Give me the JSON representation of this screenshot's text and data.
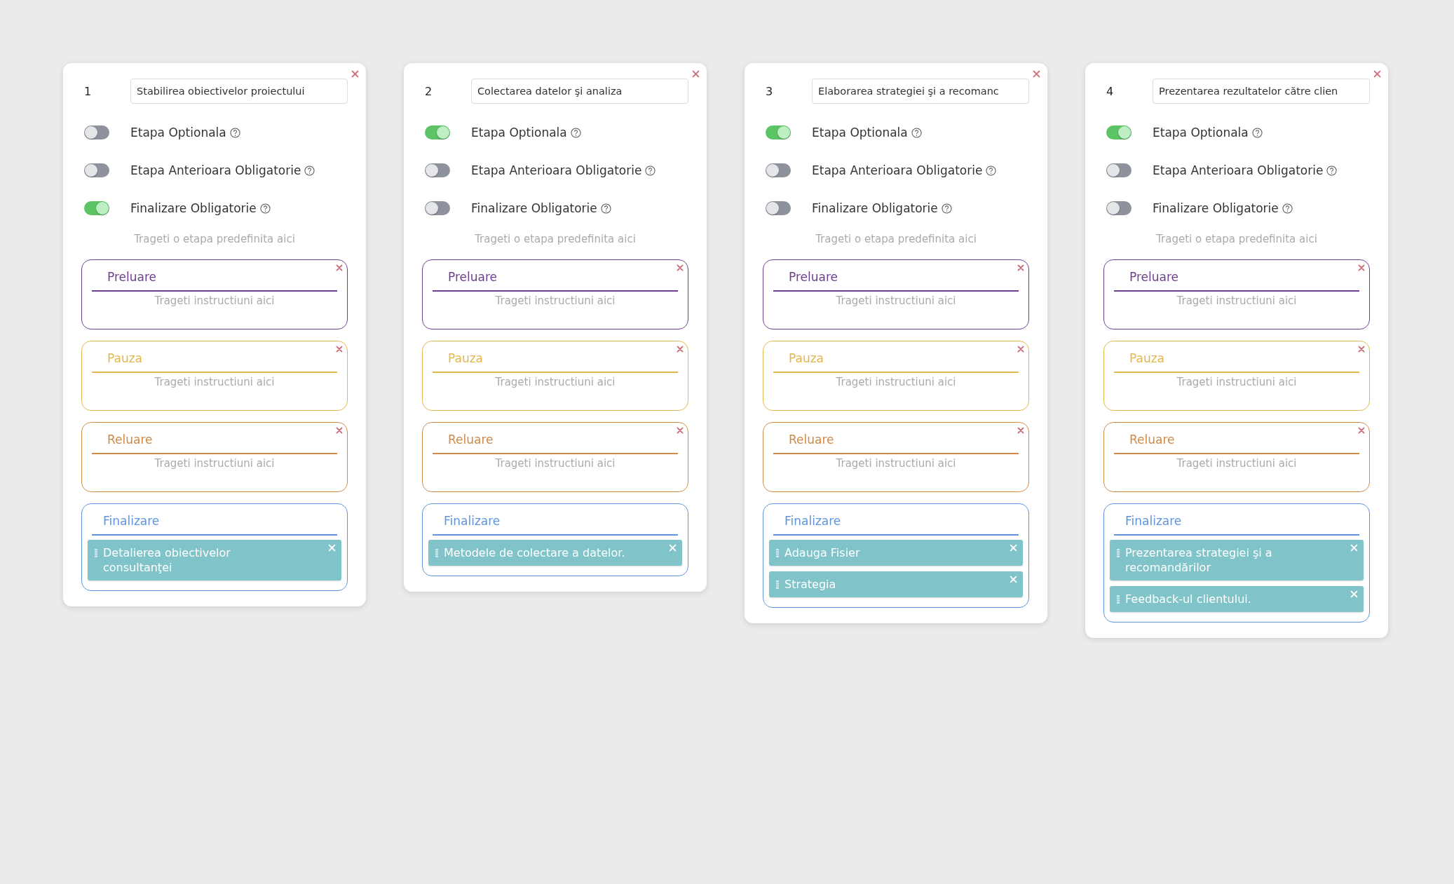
{
  "stages": [
    {
      "number": "1",
      "title": "Stabilirea obiectivelor proiectului",
      "options": [
        {
          "label": "Etapa Optionala",
          "on": false
        },
        {
          "label": "Etapa Anterioara Obligatorie",
          "on": false
        },
        {
          "label": "Finalizare Obligatorie",
          "on": true
        }
      ],
      "drop_hint": "Trageti o etapa predefinita aici",
      "sections": [
        {
          "title": "Preluare",
          "color": "#6f3f8f",
          "closable": true,
          "hint": "Trageti instructiuni aici"
        },
        {
          "title": "Pauza",
          "color": "#e2b84e",
          "closable": true,
          "hint": "Trageti instructiuni aici"
        },
        {
          "title": "Reluare",
          "color": "#d08a48",
          "closable": true,
          "hint": "Trageti instructiuni aici"
        },
        {
          "title": "Finalizare",
          "color": "#5f95de",
          "closable": false,
          "items": [
            "Detalierea obiectivelor consultanţei"
          ]
        }
      ]
    },
    {
      "number": "2",
      "title": "Colectarea datelor şi analiza",
      "options": [
        {
          "label": "Etapa Optionala",
          "on": true
        },
        {
          "label": "Etapa Anterioara Obligatorie",
          "on": false
        },
        {
          "label": "Finalizare Obligatorie",
          "on": false
        }
      ],
      "drop_hint": "Trageti o etapa predefinita aici",
      "sections": [
        {
          "title": "Preluare",
          "color": "#6f3f8f",
          "closable": true,
          "hint": "Trageti instructiuni aici"
        },
        {
          "title": "Pauza",
          "color": "#e2b84e",
          "closable": true,
          "hint": "Trageti instructiuni aici"
        },
        {
          "title": "Reluare",
          "color": "#d08a48",
          "closable": true,
          "hint": "Trageti instructiuni aici"
        },
        {
          "title": "Finalizare",
          "color": "#5f95de",
          "closable": false,
          "items": [
            "Metodele de colectare a datelor."
          ]
        }
      ]
    },
    {
      "number": "3",
      "title": "Elaborarea strategiei şi a recomanc",
      "options": [
        {
          "label": "Etapa Optionala",
          "on": true
        },
        {
          "label": "Etapa Anterioara Obligatorie",
          "on": false
        },
        {
          "label": "Finalizare Obligatorie",
          "on": false
        }
      ],
      "drop_hint": "Trageti o etapa predefinita aici",
      "sections": [
        {
          "title": "Preluare",
          "color": "#6f3f8f",
          "closable": true,
          "hint": "Trageti instructiuni aici"
        },
        {
          "title": "Pauza",
          "color": "#e2b84e",
          "closable": true,
          "hint": "Trageti instructiuni aici"
        },
        {
          "title": "Reluare",
          "color": "#d08a48",
          "closable": true,
          "hint": "Trageti instructiuni aici"
        },
        {
          "title": "Finalizare",
          "color": "#5f95de",
          "closable": false,
          "items": [
            "Adauga Fisier",
            "Strategia"
          ]
        }
      ]
    },
    {
      "number": "4",
      "title": "Prezentarea rezultatelor către clien",
      "options": [
        {
          "label": "Etapa Optionala",
          "on": true
        },
        {
          "label": "Etapa Anterioara Obligatorie",
          "on": false
        },
        {
          "label": "Finalizare Obligatorie",
          "on": false
        }
      ],
      "drop_hint": "Trageti o etapa predefinita aici",
      "sections": [
        {
          "title": "Preluare",
          "color": "#6f3f8f",
          "closable": true,
          "hint": "Trageti instructiuni aici"
        },
        {
          "title": "Pauza",
          "color": "#e2b84e",
          "closable": true,
          "hint": "Trageti instructiuni aici"
        },
        {
          "title": "Reluare",
          "color": "#d08a48",
          "closable": true,
          "hint": "Trageti instructiuni aici"
        },
        {
          "title": "Finalizare",
          "color": "#5f95de",
          "closable": false,
          "items": [
            "Prezentarea strategiei şi a recomandărilor",
            "Feedback-ul clientului."
          ]
        }
      ]
    }
  ]
}
